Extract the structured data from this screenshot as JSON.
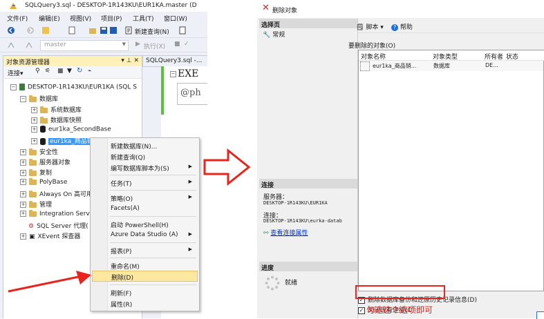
{
  "ssms": {
    "window_title": "SQLQuery3.sql - DESKTOP-1R143KU\\EUR1KA.master (D",
    "menu": [
      "文件(F)",
      "编辑(E)",
      "视图(V)",
      "项目(P)",
      "工具(T)",
      "窗口(W)"
    ],
    "toolbar": {
      "new_query": "新建查询(N)",
      "execute": "执行(X)",
      "database": "master"
    },
    "object_explorer": {
      "title": "对象资源管理器",
      "pins": "▾ ⊥ ✕",
      "connect": "连接",
      "tree": [
        "DESKTOP-1R143KU\\EUR1KA (SQL S",
        "数据库",
        "系统数据库",
        "数据库快照",
        "eur1ka_SecondBase",
        "eur1ka_商品销",
        "安全性",
        "服务器对象",
        "复制",
        "PolyBase",
        "Always On 高可用",
        "管理",
        "Integration Servi",
        "SQL Server 代理(",
        "XEvent 探查器"
      ]
    },
    "query_tab": "SQLQuery3.sql -...",
    "editor": {
      "line1": "EXE",
      "line2": "@ph"
    },
    "context_menu": [
      {
        "label": "新建数据库(N)...",
        "submenu": false
      },
      {
        "label": "新建查询(Q)",
        "submenu": false
      },
      {
        "label": "编写数据库脚本为(S)",
        "submenu": true
      },
      {
        "label": "任务(T)",
        "submenu": true
      },
      {
        "label": "策略(O)",
        "submenu": true
      },
      {
        "label": "Facets(A)",
        "submenu": false
      },
      {
        "label": "启动 PowerShell(H)",
        "submenu": false
      },
      {
        "label": "Azure Data Studio (A)",
        "submenu": true
      },
      {
        "label": "报表(P)",
        "submenu": true
      },
      {
        "label": "重命名(M)",
        "submenu": false
      },
      {
        "label": "删除(D)",
        "submenu": false
      },
      {
        "label": "刷新(F)",
        "submenu": false
      },
      {
        "label": "属性(R)",
        "submenu": false
      }
    ],
    "highlighted_menu_item": "删除(D)"
  },
  "dialog": {
    "title": "删除对象",
    "left": {
      "select_page": "选择页",
      "page_general": "常规",
      "connection": "连接",
      "server_label": "服务器：",
      "server_value": "DESKTOP-1R143KU\\EUR1KA",
      "conn_label": "连接：",
      "conn_value": "DESKTOP-1R143KU\\eurka-datab",
      "view_conn_props": "查看连接属性",
      "progress": "进度",
      "ready": "就绪"
    },
    "toolbar": {
      "script": "脚本",
      "help": "帮助"
    },
    "objects_to_delete": "要删除的对象(O)",
    "grid_headers": [
      "对象名称",
      "对象类型",
      "所有者",
      "状态"
    ],
    "grid_row": {
      "name": "eur1ka_商品销...",
      "type": "数据库",
      "owner": "DE..."
    },
    "opt_backup": "删除数据库备份和还原历史记录信息(D)",
    "opt_close": "关闭现有连接(C)",
    "annotation": "勾选这个选项即可"
  },
  "colors": {
    "accent_red": "#e8241c",
    "oe_header": "#fff1b8",
    "selection_blue": "#3399ff",
    "menu_highlight": "#fde8a2"
  }
}
